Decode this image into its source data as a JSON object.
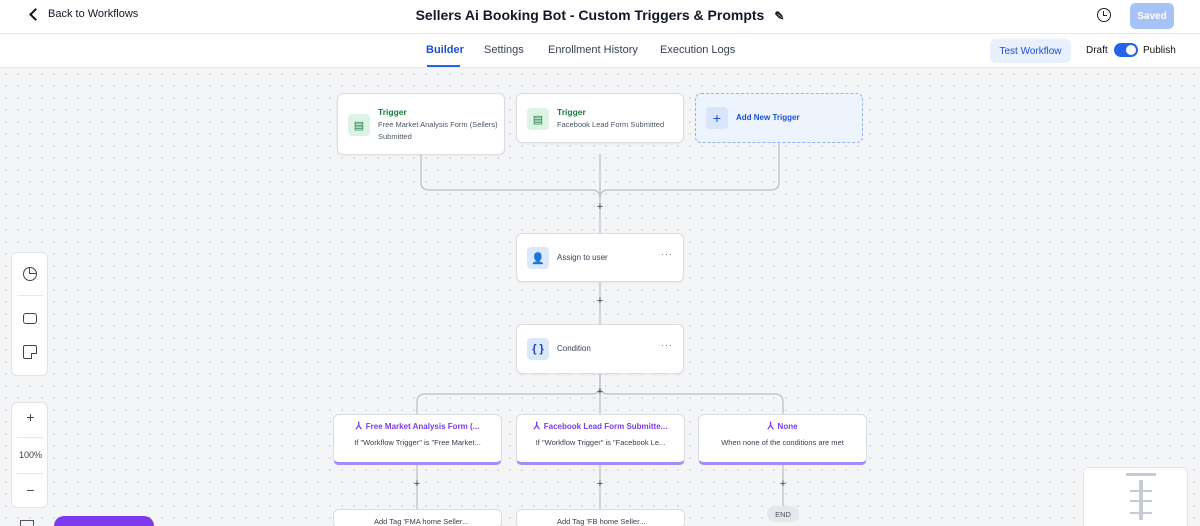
{
  "header": {
    "back_label": "Back to Workflows",
    "title": "Sellers Ai Booking Bot - Custom Triggers & Prompts",
    "saved_label": "Saved"
  },
  "tabs": [
    {
      "label": "Builder",
      "active": true
    },
    {
      "label": "Settings",
      "active": false
    },
    {
      "label": "Enrollment History",
      "active": false
    },
    {
      "label": "Execution Logs",
      "active": false
    }
  ],
  "toolbar": {
    "test_label": "Test Workflow",
    "draft_label": "Draft",
    "publish_label": "Publish",
    "publish_enabled": true
  },
  "triggers": [
    {
      "label": "Trigger",
      "description": "Free Market Analysis Form (Sellers) Submitted",
      "icon": "clipboard-icon"
    },
    {
      "label": "Trigger",
      "description": "Facebook Lead Form Submitted",
      "icon": "clipboard-icon"
    }
  ],
  "add_trigger_label": "Add New Trigger",
  "actions": {
    "assign": {
      "label": "Assign to user",
      "icon": "assign-user-icon"
    },
    "condition": {
      "label": "Condition",
      "icon": "braces-icon"
    }
  },
  "branches": [
    {
      "title": "Free Market Analysis Form (...",
      "description": "If \"Workflow Trigger\" is \"Free Market..."
    },
    {
      "title": "Facebook Lead Form Submitte...",
      "description": "If \"Workflow Trigger\" is \"Facebook Le..."
    },
    {
      "title": "None",
      "description": "When none of the conditions are met"
    }
  ],
  "partial_actions": [
    {
      "label": "Add Tag 'FMA home Seller..."
    },
    {
      "label": "Add Tag 'FB home Seller..."
    }
  ],
  "end_label": "END",
  "zoom": {
    "level": "100%"
  },
  "colors": {
    "accent": "#2563eb",
    "trigger_green": "#15803d",
    "branch_purple": "#7c3aed"
  }
}
